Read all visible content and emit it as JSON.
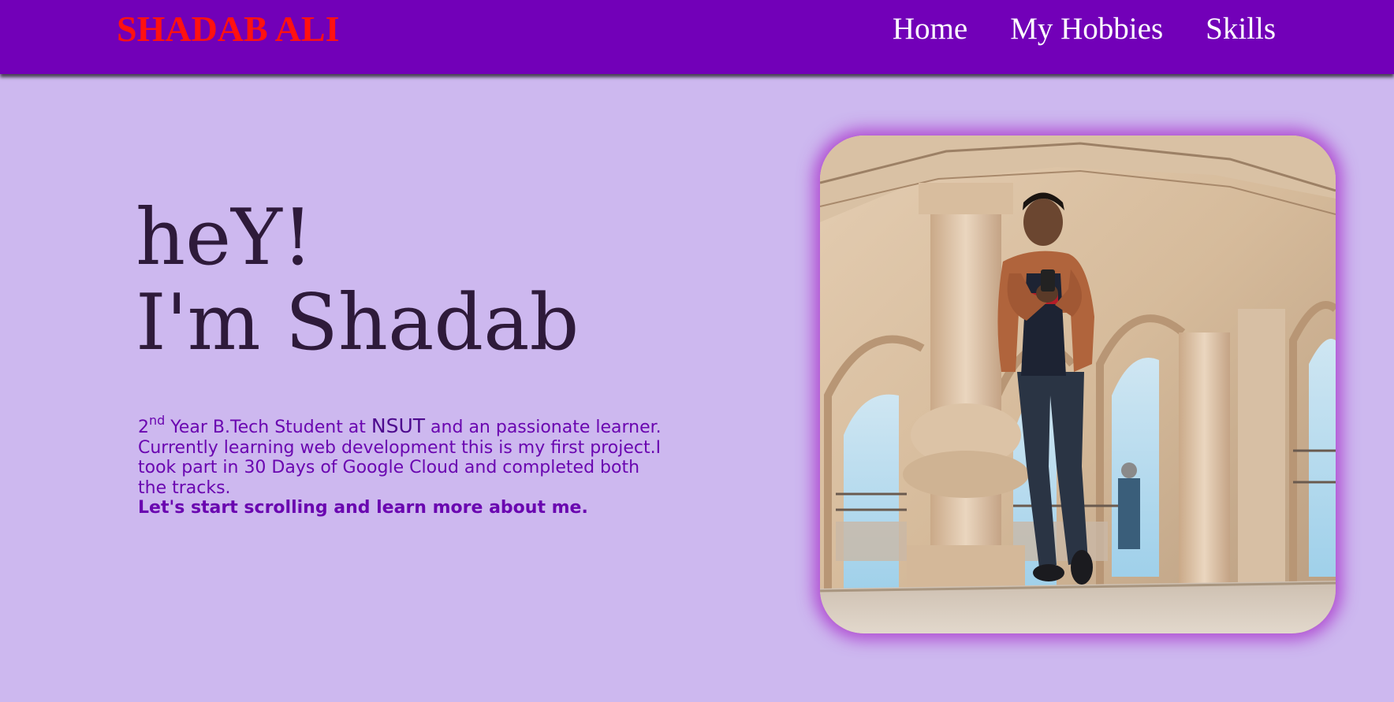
{
  "nav": {
    "brand": "SHADAB ALI",
    "links": [
      "Home",
      "My Hobbies",
      "Skills"
    ]
  },
  "hero": {
    "greeting_line1": "heY!",
    "greeting_line2": "I'm Shadab",
    "intro": {
      "year_number": "2",
      "year_suffix": "nd",
      "text_before_school": " Year B.Tech Student at ",
      "school": "NSUT",
      "text_after_school": " and an passionate learner. Currently learning web development this is my first project.I took part in 30 Days of Google Cloud and completed both the tracks.",
      "call_to_action": "Let's start scrolling and learn more about me."
    }
  },
  "colors": {
    "page_background": "#cdb8ef",
    "navbar_background": "#7200b8",
    "brand_text": "#ff1111",
    "nav_text": "#ffffff",
    "greeting_text": "#2e1a3a",
    "intro_text": "#6a06b0",
    "photo_glow": "#a528c8"
  },
  "photo": {
    "subject": "person-standing-in-palace-pavilion"
  }
}
